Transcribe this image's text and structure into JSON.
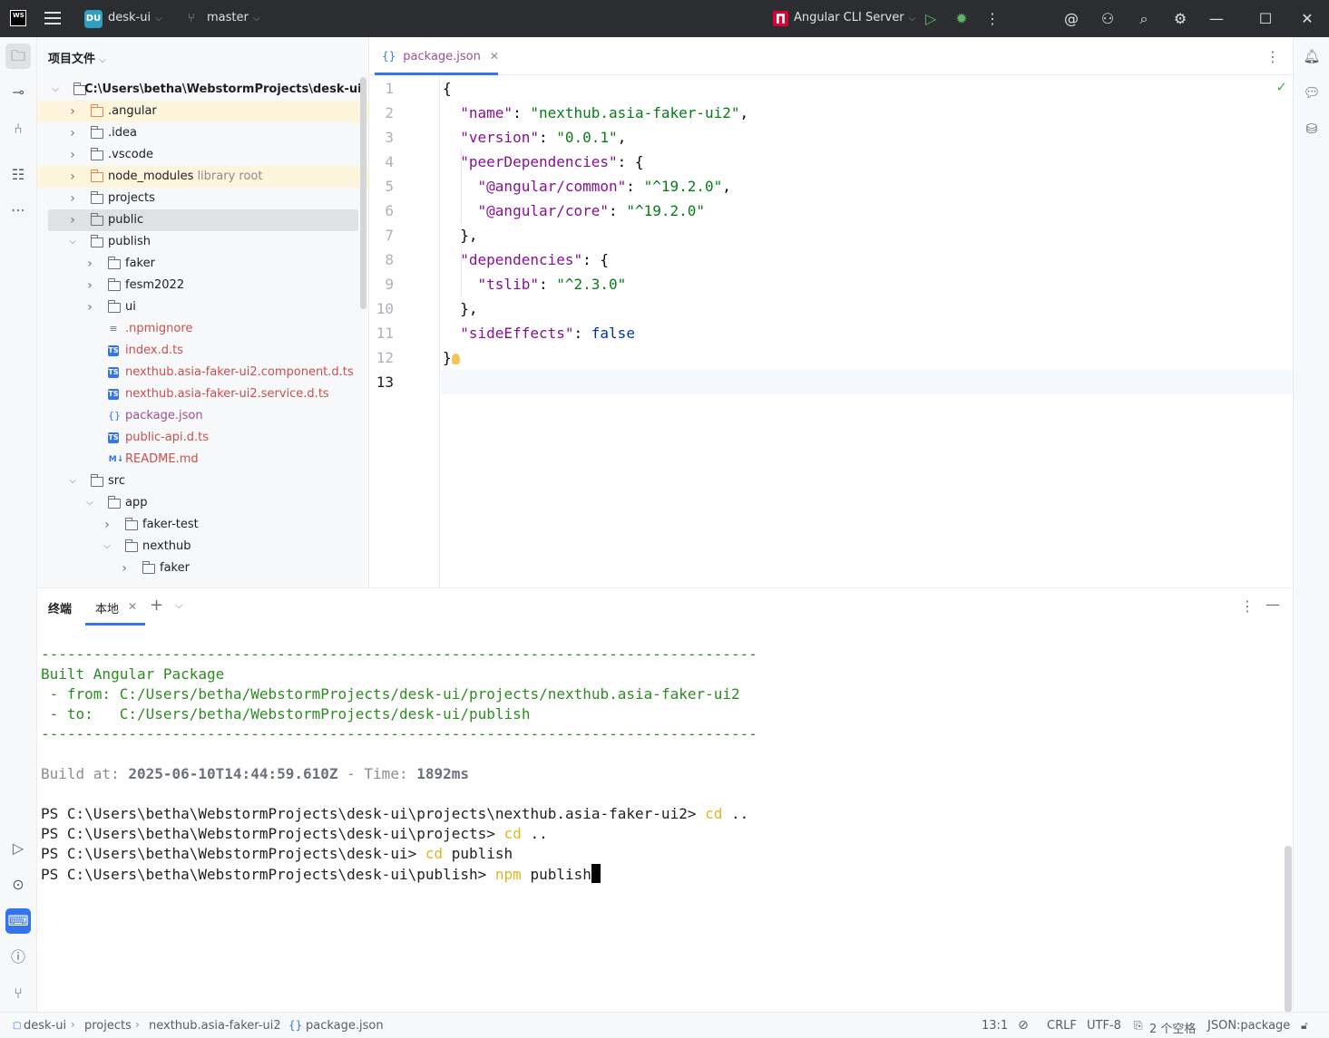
{
  "titlebar": {
    "project_badge": "DU",
    "project_name": "desk-ui",
    "branch": "master",
    "run_config": "Angular CLI Server"
  },
  "project_panel": {
    "title": "项目文件",
    "tree": [
      {
        "label": "C:\\Users\\betha\\WebstormProjects\\desk-ui",
        "depth": 0,
        "type": "folder",
        "expanded": true
      },
      {
        "label": ".angular",
        "depth": 1,
        "type": "folder-orange",
        "expanded": false
      },
      {
        "label": ".idea",
        "depth": 1,
        "type": "folder",
        "expanded": false
      },
      {
        "label": ".vscode",
        "depth": 1,
        "type": "folder",
        "expanded": false
      },
      {
        "label": "node_modules",
        "suffix": "library root",
        "depth": 1,
        "type": "folder-orange",
        "expanded": false
      },
      {
        "label": "projects",
        "depth": 1,
        "type": "folder",
        "expanded": false
      },
      {
        "label": "public",
        "depth": 1,
        "type": "folder",
        "expanded": false
      },
      {
        "label": "publish",
        "depth": 1,
        "type": "folder",
        "expanded": true
      },
      {
        "label": "faker",
        "depth": 2,
        "type": "folder",
        "expanded": false
      },
      {
        "label": "fesm2022",
        "depth": 2,
        "type": "folder",
        "expanded": false
      },
      {
        "label": "ui",
        "depth": 2,
        "type": "folder",
        "expanded": false
      },
      {
        "label": ".npmignore",
        "depth": 2,
        "type": "file-text"
      },
      {
        "label": "index.d.ts",
        "depth": 2,
        "type": "file-ts"
      },
      {
        "label": "nexthub.asia-faker-ui2.component.d.ts",
        "depth": 2,
        "type": "file-ts"
      },
      {
        "label": "nexthub.asia-faker-ui2.service.d.ts",
        "depth": 2,
        "type": "file-ts"
      },
      {
        "label": "package.json",
        "depth": 2,
        "type": "file-json"
      },
      {
        "label": "public-api.d.ts",
        "depth": 2,
        "type": "file-ts"
      },
      {
        "label": "README.md",
        "depth": 2,
        "type": "file-md"
      },
      {
        "label": "src",
        "depth": 1,
        "type": "folder",
        "expanded": true
      },
      {
        "label": "app",
        "depth": 2,
        "type": "folder",
        "expanded": true
      },
      {
        "label": "faker-test",
        "depth": 3,
        "type": "folder",
        "expanded": false
      },
      {
        "label": "nexthub",
        "depth": 3,
        "type": "folder",
        "expanded": true
      },
      {
        "label": "faker",
        "depth": 4,
        "type": "folder",
        "expanded": false
      }
    ]
  },
  "editor": {
    "tab_label": "package.json",
    "current_line": 13,
    "lines": [
      "{",
      "  \"name\": \"nexthub.asia-faker-ui2\",",
      "  \"version\": \"0.0.1\",",
      "  \"peerDependencies\": {",
      "    \"@angular/common\": \"^19.2.0\",",
      "    \"@angular/core\": \"^19.2.0\"",
      "  },",
      "  \"dependencies\": {",
      "    \"tslib\": \"^2.3.0\"",
      "  },",
      "  \"sideEffects\": false",
      "}",
      ""
    ]
  },
  "terminal": {
    "title": "终端",
    "tab_label": "本地",
    "separator": "----------------------------------------------------------------------------------",
    "built_title": "Built Angular Package",
    "from_label": " - from: ",
    "from_path": "C:/Users/betha/WebstormProjects/desk-ui/projects/nexthub.asia-faker-ui2",
    "to_label": " - to:   ",
    "to_path": "C:/Users/betha/WebstormProjects/desk-ui/publish",
    "build_at_label": "Build at: ",
    "build_at_value": "2025-06-10T14:44:59.610Z",
    "time_label": " - Time: ",
    "time_value": "1892ms",
    "commands": [
      {
        "prompt": "PS C:\\Users\\betha\\WebstormProjects\\desk-ui\\projects\\nexthub.asia-faker-ui2> ",
        "cmd": "cd",
        "args": " .."
      },
      {
        "prompt": "PS C:\\Users\\betha\\WebstormProjects\\desk-ui\\projects> ",
        "cmd": "cd",
        "args": " .."
      },
      {
        "prompt": "PS C:\\Users\\betha\\WebstormProjects\\desk-ui> ",
        "cmd": "cd",
        "args": " publish"
      },
      {
        "prompt": "PS C:\\Users\\betha\\WebstormProjects\\desk-ui\\publish> ",
        "cmd": "npm",
        "args": " publish"
      }
    ]
  },
  "statusbar": {
    "breadcrumbs": [
      "desk-ui",
      "projects",
      "nexthub.asia-faker-ui2",
      "package.json"
    ],
    "position": "13:1",
    "line_ending": "CRLF",
    "encoding": "UTF-8",
    "indent": "2 个空格",
    "file_type": "JSON:package"
  },
  "colors": {
    "accent": "#3574f0",
    "terminal_green": "#2e8b22",
    "terminal_yellow": "#e6b422",
    "json_key": "#871094",
    "json_string": "#067d17",
    "json_keyword": "#0033b3",
    "vcs_modified_file": "#c94f4f"
  }
}
